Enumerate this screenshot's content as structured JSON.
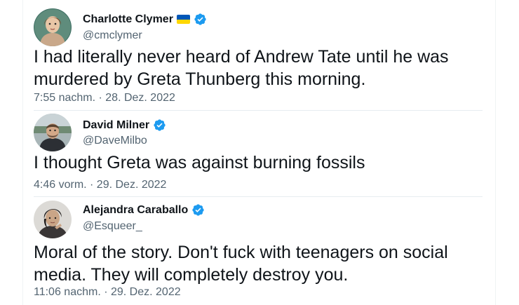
{
  "colors": {
    "verified": "#1d9bf0",
    "flag_blue": "#0057b7",
    "flag_yellow": "#ffd700",
    "text": "#0f1419",
    "muted": "#536471"
  },
  "tweets": [
    {
      "name": "Charlotte Clymer",
      "handle": "@cmclymer",
      "text": "I had literally never heard of Andrew Tate until he was murdered by Greta Thunberg this morning.",
      "timestamp": "7:55 nachm. · 28. Dez. 2022",
      "flag": "ukraine-flag",
      "verified_icon": "verified-badge-icon"
    },
    {
      "name": "David Milner",
      "handle": "@DaveMilbo",
      "text": "I thought Greta was against burning fossils",
      "timestamp": "4:46 vorm. · 29. Dez. 2022",
      "verified_icon": "verified-badge-icon"
    },
    {
      "name": "Alejandra Caraballo",
      "handle": "@Esqueer_",
      "text": "Moral of the story. Don't fuck with teenagers on social media. They will completely destroy you.",
      "timestamp": "11:06 nachm. · 29. Dez. 2022",
      "verified_icon": "verified-badge-icon"
    }
  ]
}
